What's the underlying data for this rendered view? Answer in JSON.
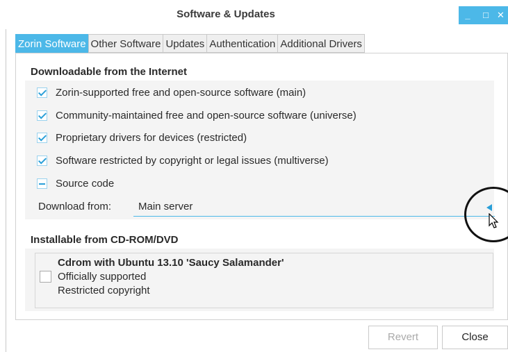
{
  "window": {
    "title": "Software & Updates",
    "controls": [
      "minimize-icon",
      "maximize-icon",
      "close-icon"
    ]
  },
  "tabs": [
    {
      "label": "Zorin Software",
      "active": true
    },
    {
      "label": "Other Software",
      "active": false
    },
    {
      "label": "Updates",
      "active": false
    },
    {
      "label": "Authentication",
      "active": false
    },
    {
      "label": "Additional Drivers",
      "active": false
    }
  ],
  "internet": {
    "heading": "Downloadable from the Internet",
    "options": [
      {
        "label": "Zorin-supported free and open-source software (main)",
        "state": "checked"
      },
      {
        "label": "Community-maintained free and open-source software (universe)",
        "state": "checked"
      },
      {
        "label": "Proprietary drivers for devices (restricted)",
        "state": "checked"
      },
      {
        "label": "Software restricted by copyright or legal issues (multiverse)",
        "state": "checked"
      },
      {
        "label": "Source code",
        "state": "mixed"
      }
    ],
    "download_from_label": "Download from:",
    "download_from_value": "Main server"
  },
  "cdrom": {
    "heading": "Installable from CD-ROM/DVD",
    "item": {
      "title": "Cdrom with Ubuntu 13.10 'Saucy Salamander'",
      "line1": "Officially supported",
      "line2": "Restricted copyright",
      "checked": false
    }
  },
  "buttons": {
    "revert": "Revert",
    "close": "Close"
  },
  "colors": {
    "accent": "#4cb8e8",
    "check": "#2a9fd8",
    "disabled_text": "#aaaaaa"
  }
}
